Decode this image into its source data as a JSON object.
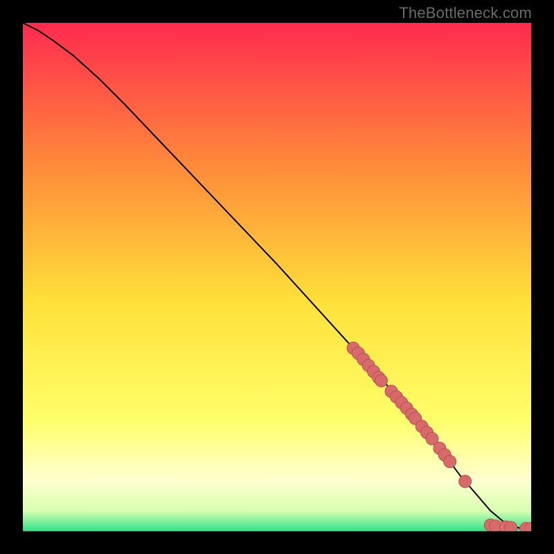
{
  "watermark": "TheBottleneck.com",
  "colors": {
    "gradient_top": "#ff2a4f",
    "gradient_mid_upper": "#ff8a3a",
    "gradient_mid": "#ffe13a",
    "gradient_mid_lower": "#ffff6a",
    "gradient_white_band": "#ffffd0",
    "gradient_green": "#2fe28a",
    "curve": "#000000",
    "marker_fill": "#d76a6a",
    "marker_stroke": "#b94f52",
    "frame": "#000000"
  },
  "chart_data": {
    "type": "line",
    "title": "",
    "xlabel": "",
    "ylabel": "",
    "xlim": [
      0,
      100
    ],
    "ylim": [
      0,
      100
    ],
    "series": [
      {
        "name": "bottleneck-curve",
        "x": [
          0,
          3,
          6,
          10,
          15,
          20,
          30,
          40,
          50,
          60,
          65,
          70,
          75,
          80,
          83,
          86,
          89,
          92,
          95,
          98,
          100
        ],
        "y": [
          100,
          98.5,
          96.5,
          93.5,
          89,
          84,
          73.5,
          63,
          52.5,
          41.5,
          36,
          30.5,
          25,
          19,
          15,
          11,
          7.5,
          4,
          1.5,
          0.5,
          0.5
        ]
      }
    ],
    "markers": [
      {
        "x": 65,
        "y": 36
      },
      {
        "x": 66,
        "y": 35
      },
      {
        "x": 67,
        "y": 33.8
      },
      {
        "x": 68,
        "y": 32.6
      },
      {
        "x": 69,
        "y": 31.4
      },
      {
        "x": 70,
        "y": 30.2
      },
      {
        "x": 70.5,
        "y": 29.6
      },
      {
        "x": 72.5,
        "y": 27.5
      },
      {
        "x": 73.5,
        "y": 26.4
      },
      {
        "x": 74.5,
        "y": 25.3
      },
      {
        "x": 75.5,
        "y": 24.2
      },
      {
        "x": 76.5,
        "y": 23
      },
      {
        "x": 77.2,
        "y": 22.2
      },
      {
        "x": 78.5,
        "y": 20.6
      },
      {
        "x": 79.5,
        "y": 19.4
      },
      {
        "x": 80.5,
        "y": 18.2
      },
      {
        "x": 82,
        "y": 16.3
      },
      {
        "x": 83,
        "y": 15
      },
      {
        "x": 84,
        "y": 13.7
      },
      {
        "x": 87,
        "y": 9.8
      },
      {
        "x": 92,
        "y": 1.2
      },
      {
        "x": 93,
        "y": 1
      },
      {
        "x": 95,
        "y": 0.8
      },
      {
        "x": 96,
        "y": 0.7
      },
      {
        "x": 99,
        "y": 0.5
      },
      {
        "x": 100,
        "y": 0.5
      }
    ]
  }
}
